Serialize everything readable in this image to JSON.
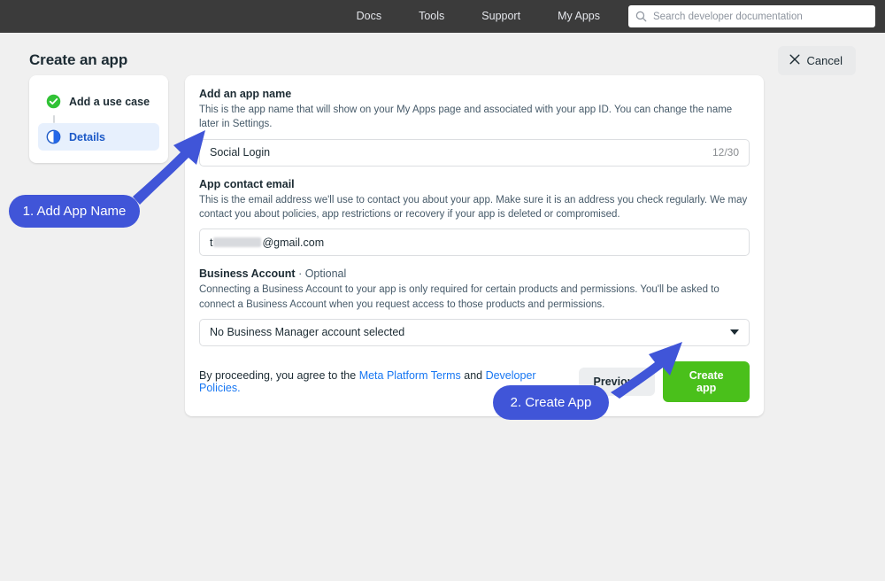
{
  "topbar": {
    "links": [
      {
        "label": "Docs",
        "name": "nav-link-docs"
      },
      {
        "label": "Tools",
        "name": "nav-link-tools"
      },
      {
        "label": "Support",
        "name": "nav-link-support"
      },
      {
        "label": "My Apps",
        "name": "nav-link-my-apps"
      }
    ],
    "search": {
      "placeholder": "Search developer documentation",
      "icon": "search-icon"
    }
  },
  "header": {
    "title": "Create an app",
    "cancel_label": "Cancel",
    "cancel_icon": "close-icon"
  },
  "steps": {
    "items": [
      {
        "label": "Add a use case",
        "state": "complete",
        "icon": "check-circle-icon"
      },
      {
        "label": "Details",
        "state": "active",
        "icon": "half-circle-icon"
      }
    ]
  },
  "form": {
    "app_name": {
      "label": "Add an app name",
      "description": "This is the app name that will show on your My Apps page and associated with your app ID. You can change the name later in Settings.",
      "value": "Social Login",
      "char_count": "12/30"
    },
    "contact_email": {
      "label": "App contact email",
      "description": "This is the email address we'll use to contact you about your app. Make sure it is an address you check regularly. We may contact you about policies, app restrictions or recovery if your app is deleted or compromised.",
      "value_prefix": "t",
      "value_suffix": "@gmail.com"
    },
    "business_account": {
      "label": "Business Account",
      "optional_suffix": "· Optional",
      "description": "Connecting a Business Account to your app is only required for certain products and permissions. You'll be asked to connect a Business Account when you request access to those products and permissions.",
      "selected": "No Business Manager account selected"
    },
    "footer": {
      "legal_prefix": "By proceeding, you agree to the ",
      "legal_link_1": "Meta Platform Terms",
      "legal_middle": " and ",
      "legal_link_2": "Developer Policies.",
      "previous_label": "Previous",
      "create_label": "Create app"
    }
  },
  "annotations": [
    {
      "label": "1. Add App Name",
      "name": "callout-add-app-name"
    },
    {
      "label": "2. Create App",
      "name": "callout-create-app"
    }
  ],
  "colors": {
    "accent_blue": "#4055d8",
    "link_blue": "#1877f2",
    "success_green": "#4ac01b",
    "topbar_dark": "#3b3b3b",
    "page_bg": "#f0f0f0",
    "active_step_bg": "#e7f0fd"
  }
}
